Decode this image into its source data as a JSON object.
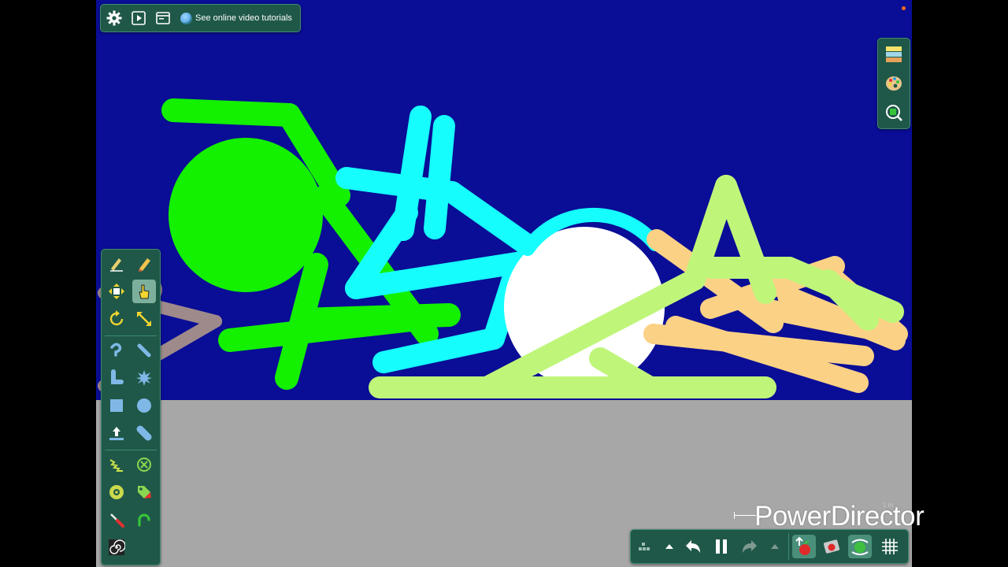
{
  "colors": {
    "sky": "#0a0d96",
    "ground": "#a7a7a7",
    "green_figure": "#13f000",
    "cyan_figure": "#16fdfd",
    "lime_figure": "#bff67a",
    "orange_figure": "#fbd185",
    "gray_figure": "#9e8a8a",
    "ball": "#ffffff",
    "toolbar_bg": "#1f5848",
    "status_dot": "#ff6a1a"
  },
  "top_toolbar": {
    "settings_icon": "gear-icon",
    "play_icon": "play-preview-icon",
    "window_icon": "window-icon",
    "tutorial_label": "See online video tutorials"
  },
  "left_toolbar": {
    "tools": [
      "pencil-edit-icon",
      "eraser-pen-icon",
      "move-icon",
      "hand-pointer-icon",
      "rotate-icon",
      "scale-icon",
      "curve-icon",
      "straight-line-icon",
      "bend-icon",
      "burst-icon",
      "rectangle-icon",
      "circle-icon",
      "import-icon",
      "capsule-icon",
      "spring-icon",
      "delete-joint-icon",
      "wheel-icon",
      "color-tag-icon",
      "knife-icon",
      "loop-icon",
      "spiral-icon"
    ],
    "selected_tool": "hand-pointer-icon"
  },
  "right_panel": {
    "buttons": [
      "layers-icon",
      "palette-icon",
      "zoom-icon"
    ]
  },
  "bottom_toolbar": {
    "buttons": [
      "grid-menu-icon",
      "expand-up-icon",
      "undo-icon",
      "pause-icon",
      "redo-icon",
      "expand-up-icon-2",
      "apple-physics-icon",
      "card-apple-icon",
      "collision-icon",
      "grid-icon"
    ]
  },
  "watermark": "PowerDirector",
  "scale_label": "1 m"
}
